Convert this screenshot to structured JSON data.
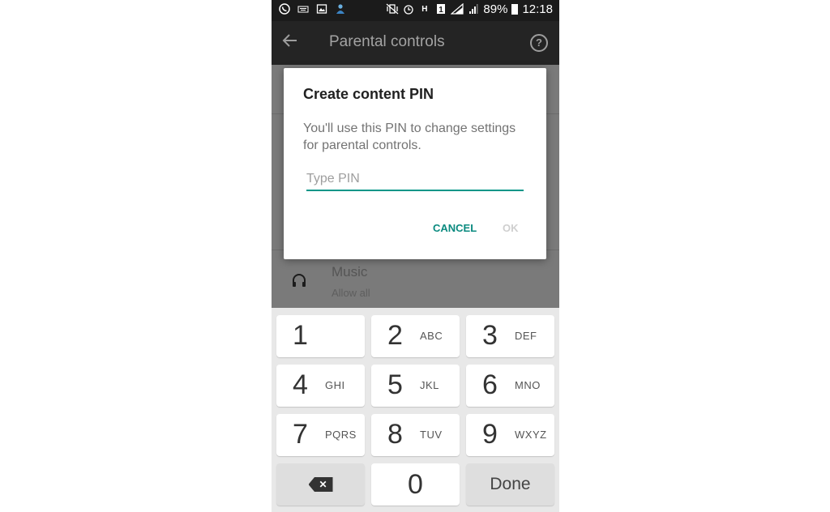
{
  "status_bar": {
    "battery_percent": "89%",
    "time": "12:18",
    "left_icons": [
      "viber-icon",
      "keyboard-icon",
      "gallery-icon",
      "person-icon"
    ],
    "right_icons": [
      "vibrate-icon",
      "alarm-icon",
      "h-signal-icon",
      "sim1-icon",
      "signal-icon",
      "signal-2-icon",
      "battery-icon"
    ]
  },
  "app_bar": {
    "title": "Parental controls",
    "back_icon": "arrow-left-icon",
    "help_glyph": "?"
  },
  "background_list": {
    "music_title": "Music",
    "music_subtitle": "Allow all",
    "music_icon": "headphones-icon"
  },
  "dialog": {
    "title": "Create content PIN",
    "message": "You'll use this PIN to change settings for parental controls.",
    "input_value": "",
    "input_placeholder": "Type PIN",
    "cancel_label": "CANCEL",
    "ok_label": "OK",
    "accent_color": "#009688"
  },
  "keypad": {
    "keys": [
      {
        "num": "1",
        "letters": ""
      },
      {
        "num": "2",
        "letters": "ABC"
      },
      {
        "num": "3",
        "letters": "DEF"
      },
      {
        "num": "4",
        "letters": "GHI"
      },
      {
        "num": "5",
        "letters": "JKL"
      },
      {
        "num": "6",
        "letters": "MNO"
      },
      {
        "num": "7",
        "letters": "PQRS"
      },
      {
        "num": "8",
        "letters": "TUV"
      },
      {
        "num": "9",
        "letters": "WXYZ"
      }
    ],
    "zero": "0",
    "backspace_glyph": "✕",
    "done_label": "Done"
  }
}
